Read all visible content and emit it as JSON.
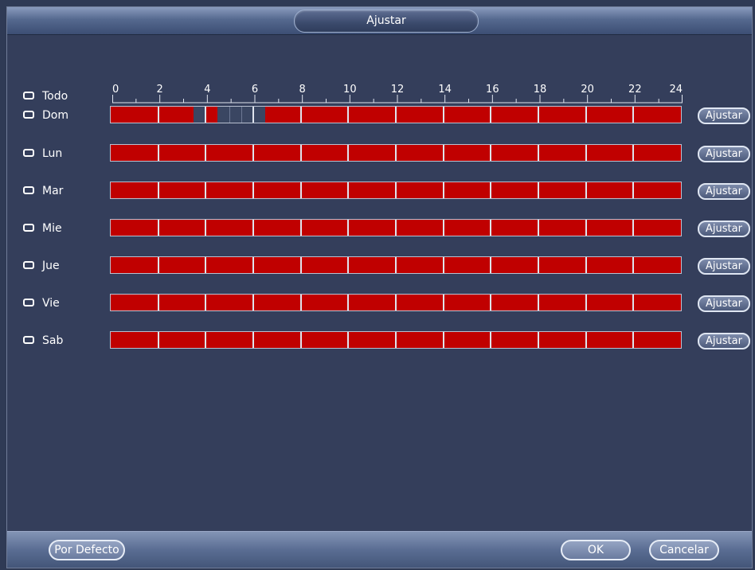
{
  "dialog": {
    "title": "Ajustar"
  },
  "select_all": {
    "label": "Todo"
  },
  "ruler": {
    "ticks": [
      "0",
      "2",
      "4",
      "6",
      "8",
      "10",
      "12",
      "14",
      "16",
      "18",
      "20",
      "22",
      "24"
    ],
    "max_hour": 24
  },
  "days": [
    {
      "label": "Dom",
      "button": "Ajustar",
      "unscheduled_hours": [
        [
          3.5,
          4.0
        ],
        [
          4.5,
          6.5
        ]
      ]
    },
    {
      "label": "Lun",
      "button": "Ajustar",
      "unscheduled_hours": []
    },
    {
      "label": "Mar",
      "button": "Ajustar",
      "unscheduled_hours": []
    },
    {
      "label": "Mie",
      "button": "Ajustar",
      "unscheduled_hours": []
    },
    {
      "label": "Jue",
      "button": "Ajustar",
      "unscheduled_hours": []
    },
    {
      "label": "Vie",
      "button": "Ajustar",
      "unscheduled_hours": []
    },
    {
      "label": "Sab",
      "button": "Ajustar",
      "unscheduled_hours": []
    }
  ],
  "footer": {
    "default_button": "Por Defecto",
    "ok_button": "OK",
    "cancel_button": "Cancelar"
  },
  "colors": {
    "scheduled": "#c00000",
    "unscheduled": "#3a4662",
    "background": "#343e5b"
  }
}
